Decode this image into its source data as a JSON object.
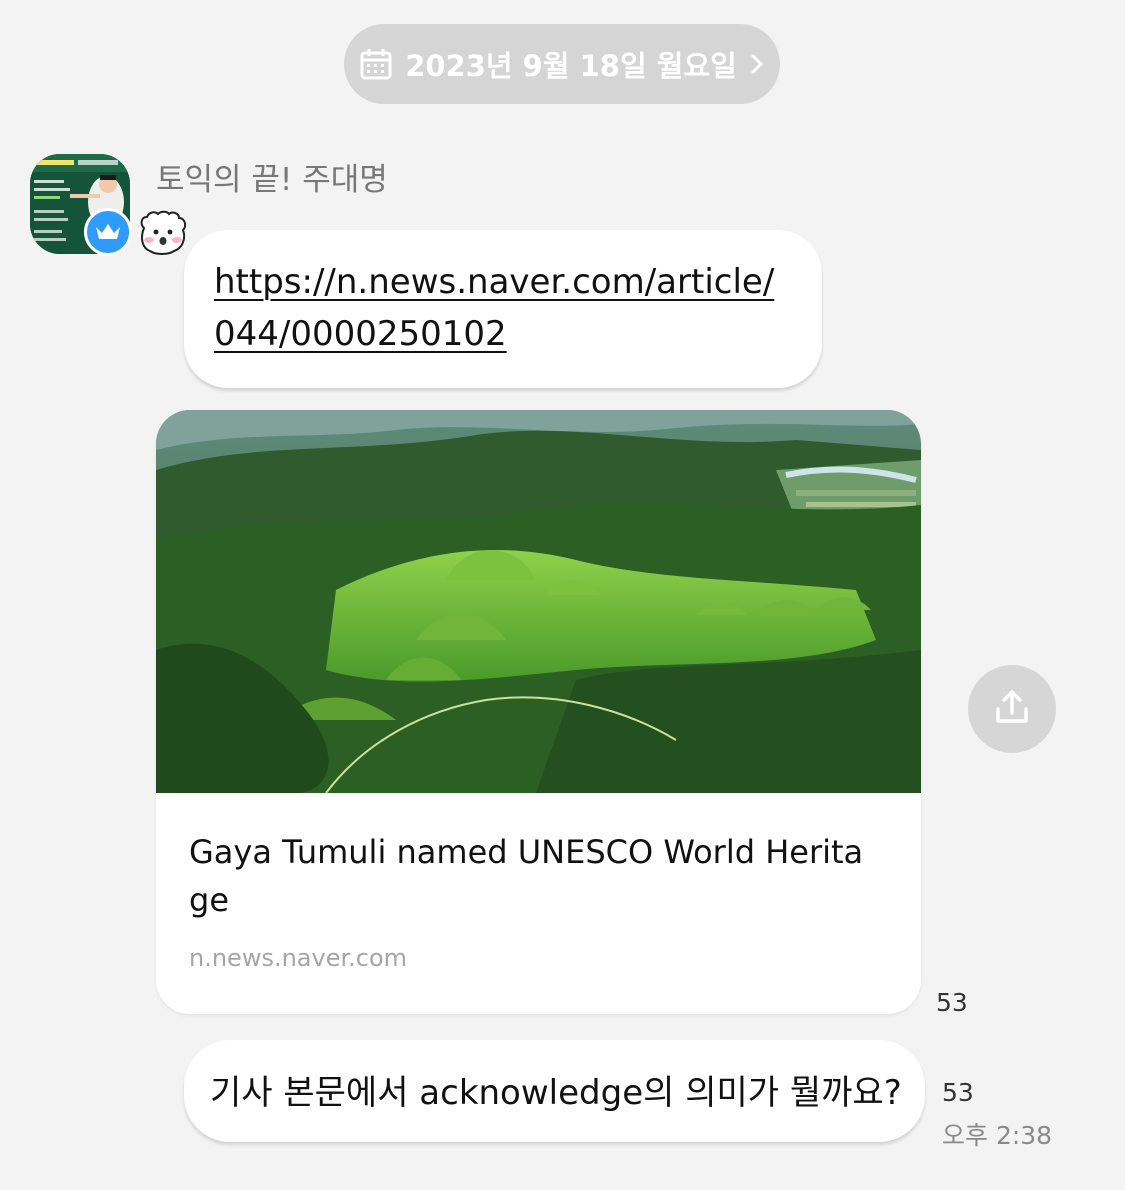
{
  "date_divider": {
    "icon": "calendar-icon",
    "text": "2023년 9월 18일 월요일",
    "chevron": "chevron-right-icon"
  },
  "sender": {
    "name": "토익의 끝! 주대명",
    "badge_icon": "crown-icon",
    "emoticon": "bear-face-icon"
  },
  "messages": [
    {
      "type": "link",
      "text": "https://n.news.naver.com/article/044/0000250102"
    },
    {
      "type": "link_preview",
      "title": "Gaya Tumuli named UNESCO World Heritage",
      "domain": "n.news.naver.com",
      "unread_count": "53",
      "share_icon": "share-icon"
    },
    {
      "type": "text",
      "text": "기사 본문에서 acknowledge의 의미가 뭘까요?",
      "unread_count": "53",
      "time": "오후 2:38"
    }
  ],
  "colors": {
    "background": "#f3f3f3",
    "bubble": "#ffffff",
    "date_pill": "#d5d5d5",
    "badge": "#2f9bff",
    "share_button": "#d6d6d6"
  }
}
